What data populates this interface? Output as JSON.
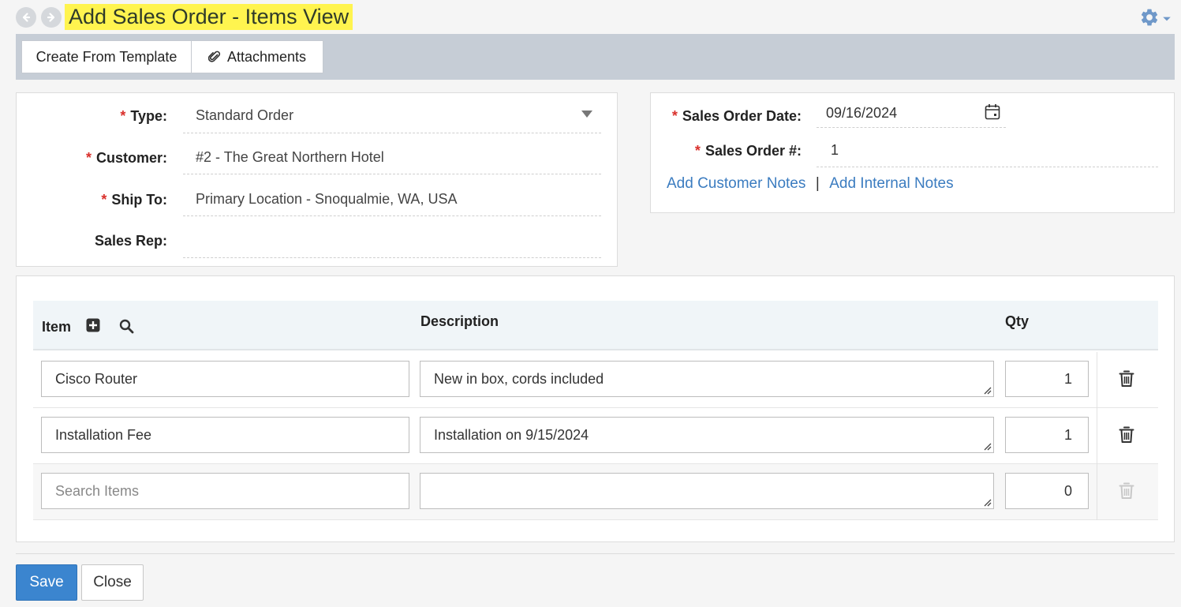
{
  "header": {
    "title": "Add Sales Order - Items View",
    "back_icon": "back-arrow-icon",
    "forward_icon": "forward-arrow-icon",
    "settings_icon": "gear-icon"
  },
  "toolbar": {
    "create_from_template": "Create From Template",
    "attachments": "Attachments"
  },
  "order_form": {
    "type_label": "Type:",
    "type_value": "Standard Order",
    "customer_label": "Customer:",
    "customer_value": "#2 - The Great Northern Hotel",
    "ship_to_label": "Ship To:",
    "ship_to_value": "Primary Location - Snoqualmie, WA, USA",
    "sales_rep_label": "Sales Rep:",
    "sales_rep_value": ""
  },
  "order_meta": {
    "date_label": "Sales Order Date:",
    "date_value": "09/16/2024",
    "number_label": "Sales Order #:",
    "number_value": "1",
    "add_customer_notes": "Add Customer Notes",
    "separator": "|",
    "add_internal_notes": "Add Internal Notes"
  },
  "items_table": {
    "col_item": "Item",
    "col_description": "Description",
    "col_qty": "Qty",
    "rows": [
      {
        "item": "Cisco Router",
        "description": "New in box, cords included",
        "qty": "1"
      },
      {
        "item": "Installation Fee",
        "description": "Installation on 9/15/2024",
        "qty": "1"
      }
    ],
    "new_row": {
      "item_placeholder": "Search Items",
      "description": "",
      "qty": "0"
    }
  },
  "footer": {
    "save": "Save",
    "close": "Close"
  },
  "colors": {
    "title_highlight": "#fff44f",
    "toolbar_bg": "#c6cdd6",
    "primary": "#3b85cf",
    "link": "#3b7cc0",
    "required": "#d9302c"
  }
}
